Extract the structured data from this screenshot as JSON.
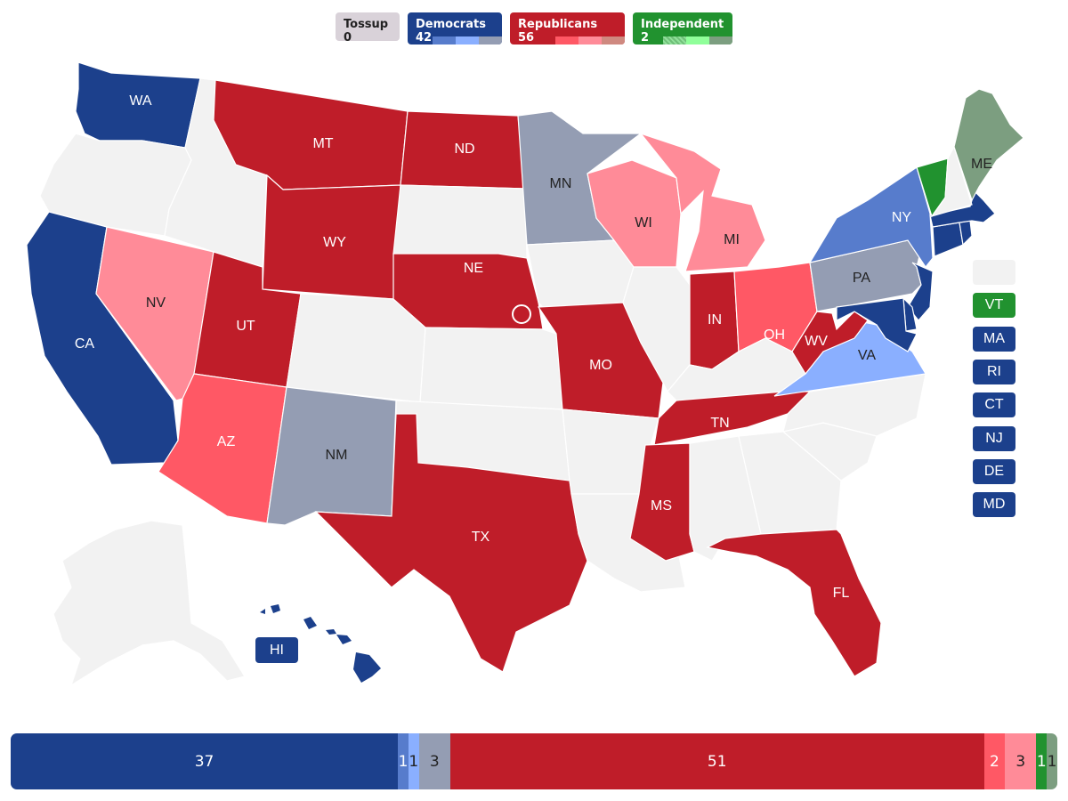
{
  "legend": {
    "tossup": {
      "label": "Tossup 0"
    },
    "democrats": {
      "label": "Democrats 42",
      "shades": [
        "#577ccc",
        "#8aafff",
        "#949db3"
      ]
    },
    "republicans": {
      "label": "Republicans 56",
      "shades": [
        "#ff5865",
        "#ff8b98",
        "#cf8980"
      ]
    },
    "independent": {
      "label": "Independent 2",
      "shades": [
        "#90e09a",
        "#90ff9a",
        "#7c9e80"
      ]
    }
  },
  "colors": {
    "dem_solid": "#1c408c",
    "dem_likely": "#577ccc",
    "dem_lean": "#8aafff",
    "dem_tilt": "#949db3",
    "rep_solid": "#bf1d29",
    "rep_likely": "#ff5865",
    "rep_lean": "#ff8b98",
    "rep_tilt": "#cf8980",
    "ind_solid": "#21922f",
    "ind_tilt": "#7c9e80",
    "no_race": "#f2f2f2",
    "tossup": "#d9d2d9"
  },
  "states": [
    {
      "abbr": "WA",
      "rating": "dem_solid"
    },
    {
      "abbr": "OR",
      "rating": "no_race"
    },
    {
      "abbr": "CA",
      "rating": "dem_solid"
    },
    {
      "abbr": "NV",
      "rating": "rep_lean"
    },
    {
      "abbr": "ID",
      "rating": "no_race"
    },
    {
      "abbr": "MT",
      "rating": "rep_solid"
    },
    {
      "abbr": "WY",
      "rating": "rep_solid"
    },
    {
      "abbr": "UT",
      "rating": "rep_solid"
    },
    {
      "abbr": "AZ",
      "rating": "rep_likely"
    },
    {
      "abbr": "CO",
      "rating": "no_race"
    },
    {
      "abbr": "NM",
      "rating": "dem_tilt"
    },
    {
      "abbr": "ND",
      "rating": "rep_solid"
    },
    {
      "abbr": "SD",
      "rating": "no_race"
    },
    {
      "abbr": "NE",
      "rating": "rep_solid"
    },
    {
      "abbr": "KS",
      "rating": "no_race"
    },
    {
      "abbr": "OK",
      "rating": "no_race"
    },
    {
      "abbr": "TX",
      "rating": "rep_solid"
    },
    {
      "abbr": "MN",
      "rating": "dem_tilt"
    },
    {
      "abbr": "IA",
      "rating": "no_race"
    },
    {
      "abbr": "MO",
      "rating": "rep_solid"
    },
    {
      "abbr": "AR",
      "rating": "no_race"
    },
    {
      "abbr": "LA",
      "rating": "no_race"
    },
    {
      "abbr": "WI",
      "rating": "rep_lean"
    },
    {
      "abbr": "IL",
      "rating": "no_race"
    },
    {
      "abbr": "MI",
      "rating": "rep_lean"
    },
    {
      "abbr": "IN",
      "rating": "rep_solid"
    },
    {
      "abbr": "OH",
      "rating": "rep_likely"
    },
    {
      "abbr": "KY",
      "rating": "no_race"
    },
    {
      "abbr": "TN",
      "rating": "rep_solid"
    },
    {
      "abbr": "MS",
      "rating": "rep_solid"
    },
    {
      "abbr": "AL",
      "rating": "no_race"
    },
    {
      "abbr": "GA",
      "rating": "no_race"
    },
    {
      "abbr": "FL",
      "rating": "rep_solid"
    },
    {
      "abbr": "SC",
      "rating": "no_race"
    },
    {
      "abbr": "NC",
      "rating": "no_race"
    },
    {
      "abbr": "VA",
      "rating": "dem_lean"
    },
    {
      "abbr": "WV",
      "rating": "rep_solid"
    },
    {
      "abbr": "PA",
      "rating": "dem_tilt"
    },
    {
      "abbr": "NY",
      "rating": "dem_likely"
    },
    {
      "abbr": "VT",
      "rating": "ind_solid"
    },
    {
      "abbr": "NH",
      "rating": "no_race"
    },
    {
      "abbr": "ME",
      "rating": "ind_tilt"
    },
    {
      "abbr": "MA",
      "rating": "dem_solid"
    },
    {
      "abbr": "RI",
      "rating": "dem_solid"
    },
    {
      "abbr": "CT",
      "rating": "dem_solid"
    },
    {
      "abbr": "NJ",
      "rating": "dem_solid"
    },
    {
      "abbr": "DE",
      "rating": "dem_solid"
    },
    {
      "abbr": "MD",
      "rating": "dem_solid"
    },
    {
      "abbr": "AK",
      "rating": "no_race"
    },
    {
      "abbr": "HI",
      "rating": "dem_solid"
    }
  ],
  "labels": {
    "WA": "WA",
    "CA": "CA",
    "NV": "NV",
    "MT": "MT",
    "WY": "WY",
    "UT": "UT",
    "AZ": "AZ",
    "NM": "NM",
    "ND": "ND",
    "NE": "NE",
    "TX": "TX",
    "MN": "MN",
    "MO": "MO",
    "WI": "WI",
    "MI": "MI",
    "IN": "IN",
    "OH": "OH",
    "TN": "TN",
    "MS": "MS",
    "FL": "FL",
    "VA": "VA",
    "WV": "WV",
    "PA": "PA",
    "NY": "NY",
    "ME": "ME"
  },
  "side_boxes": [
    {
      "abbr": "",
      "rating": "no_race"
    },
    {
      "abbr": "VT",
      "rating": "ind_solid"
    },
    {
      "abbr": "MA",
      "rating": "dem_solid"
    },
    {
      "abbr": "RI",
      "rating": "dem_solid"
    },
    {
      "abbr": "CT",
      "rating": "dem_solid"
    },
    {
      "abbr": "NJ",
      "rating": "dem_solid"
    },
    {
      "abbr": "DE",
      "rating": "dem_solid"
    },
    {
      "abbr": "MD",
      "rating": "dem_solid"
    }
  ],
  "hi_box": {
    "abbr": "HI"
  },
  "seat_bar": [
    {
      "key": "dem_solid",
      "value": 37,
      "label": "37",
      "color": "#1c408c",
      "text": "#ffffff"
    },
    {
      "key": "dem_likely",
      "value": 1,
      "label": "1",
      "color": "#577ccc",
      "text": "#ffffff"
    },
    {
      "key": "dem_lean",
      "value": 1,
      "label": "1",
      "color": "#8aafff",
      "text": "#222222"
    },
    {
      "key": "dem_tilt",
      "value": 3,
      "label": "3",
      "color": "#949db3",
      "text": "#222222"
    },
    {
      "key": "rep_solid",
      "value": 51,
      "label": "51",
      "color": "#bf1d29",
      "text": "#ffffff"
    },
    {
      "key": "rep_likely",
      "value": 2,
      "label": "2",
      "color": "#ff5865",
      "text": "#ffffff"
    },
    {
      "key": "rep_lean",
      "value": 3,
      "label": "3",
      "color": "#ff8b98",
      "text": "#222222"
    },
    {
      "key": "ind_solid",
      "value": 1,
      "label": "1",
      "color": "#21922f",
      "text": "#ffffff"
    },
    {
      "key": "ind_tilt",
      "value": 1,
      "label": "1",
      "color": "#7c9e80",
      "text": "#222222"
    }
  ]
}
